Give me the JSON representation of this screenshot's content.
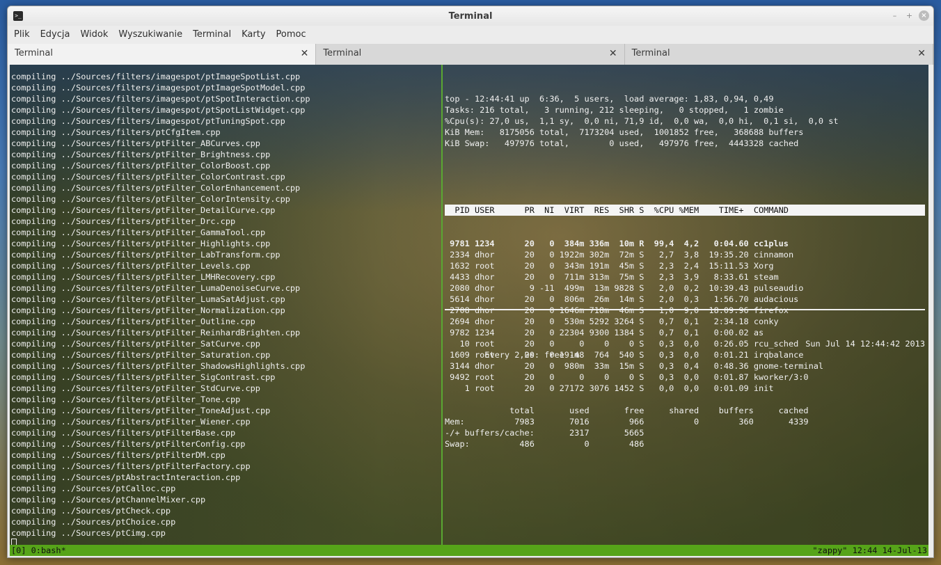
{
  "window": {
    "title": "Terminal"
  },
  "menubar": [
    "Plik",
    "Edycja",
    "Widok",
    "Wyszukiwanie",
    "Terminal",
    "Karty",
    "Pomoc"
  ],
  "tabs": [
    {
      "label": "Terminal",
      "active": true
    },
    {
      "label": "Terminal",
      "active": false
    },
    {
      "label": "Terminal",
      "active": false
    }
  ],
  "left_pane": {
    "lines": [
      "compiling ../Sources/filters/imagespot/ptImageSpotList.cpp",
      "compiling ../Sources/filters/imagespot/ptImageSpotModel.cpp",
      "compiling ../Sources/filters/imagespot/ptSpotInteraction.cpp",
      "compiling ../Sources/filters/imagespot/ptSpotListWidget.cpp",
      "compiling ../Sources/filters/imagespot/ptTuningSpot.cpp",
      "compiling ../Sources/filters/ptCfgItem.cpp",
      "compiling ../Sources/filters/ptFilter_ABCurves.cpp",
      "compiling ../Sources/filters/ptFilter_Brightness.cpp",
      "compiling ../Sources/filters/ptFilter_ColorBoost.cpp",
      "compiling ../Sources/filters/ptFilter_ColorContrast.cpp",
      "compiling ../Sources/filters/ptFilter_ColorEnhancement.cpp",
      "compiling ../Sources/filters/ptFilter_ColorIntensity.cpp",
      "compiling ../Sources/filters/ptFilter_DetailCurve.cpp",
      "compiling ../Sources/filters/ptFilter_Drc.cpp",
      "compiling ../Sources/filters/ptFilter_GammaTool.cpp",
      "compiling ../Sources/filters/ptFilter_Highlights.cpp",
      "compiling ../Sources/filters/ptFilter_LabTransform.cpp",
      "compiling ../Sources/filters/ptFilter_Levels.cpp",
      "compiling ../Sources/filters/ptFilter_LMHRecovery.cpp",
      "compiling ../Sources/filters/ptFilter_LumaDenoiseCurve.cpp",
      "compiling ../Sources/filters/ptFilter_LumaSatAdjust.cpp",
      "compiling ../Sources/filters/ptFilter_Normalization.cpp",
      "compiling ../Sources/filters/ptFilter_Outline.cpp",
      "compiling ../Sources/filters/ptFilter_ReinhardBrighten.cpp",
      "compiling ../Sources/filters/ptFilter_SatCurve.cpp",
      "compiling ../Sources/filters/ptFilter_Saturation.cpp",
      "compiling ../Sources/filters/ptFilter_ShadowsHighlights.cpp",
      "compiling ../Sources/filters/ptFilter_SigContrast.cpp",
      "compiling ../Sources/filters/ptFilter_StdCurve.cpp",
      "compiling ../Sources/filters/ptFilter_Tone.cpp",
      "compiling ../Sources/filters/ptFilter_ToneAdjust.cpp",
      "compiling ../Sources/filters/ptFilter_Wiener.cpp",
      "compiling ../Sources/filters/ptFilterBase.cpp",
      "compiling ../Sources/filters/ptFilterConfig.cpp",
      "compiling ../Sources/filters/ptFilterDM.cpp",
      "compiling ../Sources/filters/ptFilterFactory.cpp",
      "compiling ../Sources/ptAbstractInteraction.cpp",
      "compiling ../Sources/ptCalloc.cpp",
      "compiling ../Sources/ptChannelMixer.cpp",
      "compiling ../Sources/ptCheck.cpp",
      "compiling ../Sources/ptChoice.cpp",
      "compiling ../Sources/ptCimg.cpp"
    ]
  },
  "top": {
    "summary": [
      "top - 12:44:41 up  6:36,  5 users,  load average: 1,83, 0,94, 0,49",
      "Tasks: 216 total,   3 running, 212 sleeping,   0 stopped,   1 zombie",
      "%Cpu(s): 27,0 us,  1,1 sy,  0,0 ni, 71,9 id,  0,0 wa,  0,0 hi,  0,1 si,  0,0 st",
      "KiB Mem:   8175056 total,  7173204 used,  1001852 free,   368688 buffers",
      "KiB Swap:   497976 total,        0 used,   497976 free,  4443328 cached"
    ],
    "header": "  PID USER      PR  NI  VIRT  RES  SHR S  %CPU %MEM    TIME+  COMMAND",
    "processes": [
      {
        "line": " 9781 1234      20   0  384m 336m  10m R  99,4  4,2   0:04.60 cc1plus",
        "bold": true
      },
      {
        "line": " 2334 dhor      20   0 1922m 302m  72m S   2,7  3,8  19:35.20 cinnamon",
        "bold": false
      },
      {
        "line": " 1632 root      20   0  343m 191m  45m S   2,3  2,4  15:11.53 Xorg",
        "bold": false
      },
      {
        "line": " 4433 dhor      20   0  711m 313m  75m S   2,3  3,9   8:33.61 steam",
        "bold": false
      },
      {
        "line": " 2080 dhor       9 -11  499m  13m 9828 S   2,0  0,2  10:39.43 pulseaudio",
        "bold": false
      },
      {
        "line": " 5614 dhor      20   0  806m  26m  14m S   2,0  0,3   1:56.70 audacious",
        "bold": false
      },
      {
        "line": " 2708 dhor      20   0 1646m 718m  46m S   1,0  9,0  18:09.96 firefox",
        "bold": false
      },
      {
        "line": " 2694 dhor      20   0  530m 5292 3264 S   0,7  0,1   2:34.18 conky",
        "bold": false
      },
      {
        "line": " 9782 1234      20   0 22304 9300 1384 S   0,7  0,1   0:00.02 as",
        "bold": false
      },
      {
        "line": "   10 root      20   0     0    0    0 S   0,3  0,0   0:26.05 rcu_sched",
        "bold": false
      },
      {
        "line": " 1609 root      20   0 19148  764  540 S   0,3  0,0   0:01.21 irqbalance",
        "bold": false
      },
      {
        "line": " 3144 dhor      20   0  980m  33m  15m S   0,3  0,4   0:48.36 gnome-terminal",
        "bold": false
      },
      {
        "line": " 9492 root      20   0     0    0    0 S   0,3  0,0   0:01.87 kworker/3:0",
        "bold": false
      },
      {
        "line": "    1 root      20   0 27172 3076 1452 S   0,0  0,0   0:01.09 init",
        "bold": false
      }
    ]
  },
  "watch": {
    "command": "Every 2,0s: free -m",
    "timestamp": "Sun Jul 14 12:44:42 2013",
    "lines": [
      "             total       used       free     shared    buffers     cached",
      "Mem:          7983       7016        966          0        360       4339",
      "-/+ buffers/cache:       2317       5665",
      "Swap:          486          0        486"
    ]
  },
  "statusbar": {
    "left": "[0] 0:bash*",
    "right": "\"zappy\" 12:44 14-Jul-13"
  }
}
